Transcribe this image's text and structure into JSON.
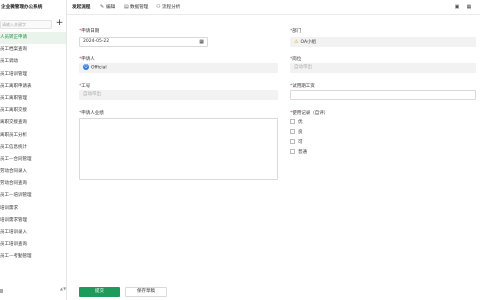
{
  "app": {
    "title": "企业微管理办公系统"
  },
  "sidebar": {
    "search_placeholder": "请输入关键字",
    "add_label": "+",
    "items": [
      {
        "label": "人员转正申请",
        "active": true
      },
      {
        "label": "员工档案查询"
      },
      {
        "label": "员工调动"
      },
      {
        "label": "员工培训管理"
      },
      {
        "label": "员工离职申请表"
      },
      {
        "label": "员工离职管理"
      },
      {
        "label": "员工离职交接"
      },
      {
        "label": "离职交接查询"
      },
      {
        "label": "离职员工分析"
      },
      {
        "label": "员工信息统计"
      },
      {
        "label": "员工—合同管理"
      },
      {
        "label": "劳动合同录入"
      },
      {
        "label": "劳动合同查询"
      },
      {
        "label": "员工—培训管理"
      },
      {
        "label": "培训需求"
      },
      {
        "label": "培训需求管理"
      },
      {
        "label": "员工培训录入"
      },
      {
        "label": "员工培训查询"
      },
      {
        "label": "员工—考勤管理"
      }
    ],
    "footer": "Ⅲ",
    "scroll_indicator": "▲▼"
  },
  "toolbar": {
    "title": "发起流程",
    "items": [
      {
        "icon": "edit-icon",
        "glyph": "✎",
        "label": "编辑"
      },
      {
        "icon": "data-manage-icon",
        "glyph": "▤",
        "label": "数据管理"
      },
      {
        "icon": "flow-analysis-icon",
        "glyph": "⚇",
        "label": "流程分析"
      }
    ],
    "right_icons": [
      {
        "icon": "export-icon",
        "glyph": "▣"
      },
      {
        "icon": "settings-icon",
        "glyph": "▦"
      }
    ]
  },
  "form": {
    "apply_date": {
      "label": "申请日期",
      "value": "2024-05-22"
    },
    "department": {
      "label": "部门",
      "value": "OA小组"
    },
    "applicant": {
      "label": "申请人",
      "value": "Official"
    },
    "position": {
      "label": "岗位",
      "placeholder": "自动带出"
    },
    "employee_no": {
      "label": "工号",
      "placeholder": "自动带出"
    },
    "probation_salary": {
      "label": "试用期工资",
      "value": ""
    },
    "business_desc": {
      "label": "申请人业绩"
    },
    "evaluation": {
      "label": "使用记录（自评）",
      "options": [
        "优",
        "良",
        "可",
        "普通"
      ]
    },
    "submit_label": "提交",
    "save_draft_label": "保存草稿"
  },
  "colors": {
    "accent": "#1e9b5a",
    "active_bg": "#eaf3ec",
    "warning": "#e8a317",
    "avatar": "#2b7bd6"
  }
}
